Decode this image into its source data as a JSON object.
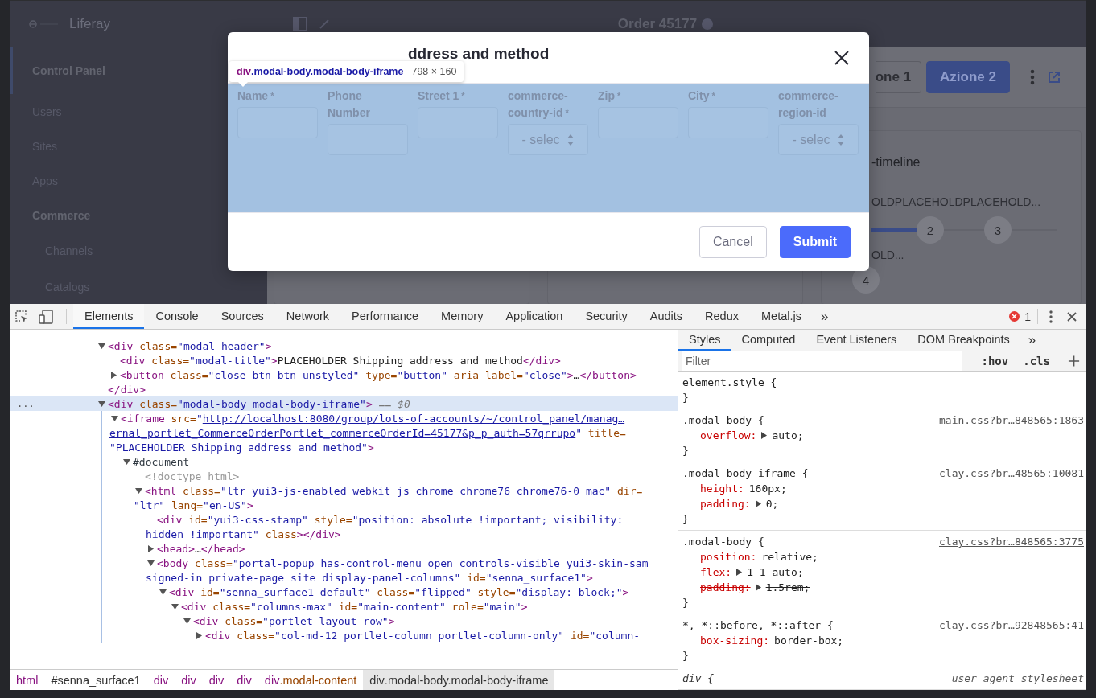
{
  "app": {
    "brand": "Liferay",
    "sidebar": [
      {
        "label": "Control Panel",
        "kind": "section",
        "selected": true
      },
      {
        "label": "Users",
        "kind": "item",
        "selected": false
      },
      {
        "label": "Sites",
        "kind": "item",
        "selected": false
      },
      {
        "label": "Apps",
        "kind": "item",
        "selected": false
      },
      {
        "label": "Commerce",
        "kind": "section",
        "selected": false
      },
      {
        "label": "Channels",
        "kind": "subitem",
        "selected": false
      },
      {
        "label": "Catalogs",
        "kind": "subitem",
        "selected": false
      }
    ],
    "title": "Order 45177",
    "actions": [
      {
        "label": "one 1",
        "kind": "secondary"
      },
      {
        "label": "Azione 2",
        "kind": "primary"
      }
    ],
    "timeline": {
      "title": "-timeline",
      "labels": [
        "OLD",
        "PLACEHOLD",
        "PLACEHOLD..."
      ],
      "steps": [
        "2",
        "3"
      ],
      "level": 0.26,
      "second_label": "OLD...",
      "second_step": "4"
    }
  },
  "modal": {
    "title": "ddress and method",
    "highlight": {
      "element": "div",
      "classes": ".modal-body.modal-body-iframe",
      "size": "798 × 160"
    },
    "fields": [
      {
        "label": "Name",
        "mark": "*",
        "kind": "input"
      },
      {
        "label": "Phone Number",
        "kind": "input"
      },
      {
        "label": "Street 1",
        "mark": "*",
        "kind": "input"
      },
      {
        "label": "commerce-country-id",
        "mark": "*",
        "kind": "select",
        "value": "- selec"
      },
      {
        "label": "Zip",
        "mark": "*",
        "kind": "input"
      },
      {
        "label": "City",
        "mark": "*",
        "kind": "input"
      },
      {
        "label": "commerce-region-id",
        "kind": "select",
        "value": "- selec"
      }
    ],
    "buttons": [
      {
        "label": "Cancel",
        "kind": "secondary"
      },
      {
        "label": "Submit",
        "kind": "primary"
      }
    ]
  },
  "devtools": {
    "tabs": [
      {
        "label": "Elements",
        "selected": true
      },
      {
        "label": "Console",
        "selected": false
      },
      {
        "label": "Sources",
        "selected": false
      },
      {
        "label": "Network",
        "selected": false
      },
      {
        "label": "Performance",
        "selected": false
      },
      {
        "label": "Memory",
        "selected": false
      },
      {
        "label": "Application",
        "selected": false
      },
      {
        "label": "Security",
        "selected": false
      },
      {
        "label": "Audits",
        "selected": false
      },
      {
        "label": "Redux",
        "selected": false
      },
      {
        "label": "Metal.js",
        "selected": false
      }
    ],
    "more": "»",
    "error_count": "1",
    "tree": [
      {
        "expanded": true,
        "selected": false,
        "lines": [
          [
            {
              "kind": "tag",
              "text": "<div"
            },
            {
              "kind": "attr",
              "text": " class="
            },
            {
              "kind": "val",
              "text": "\"modal-header\""
            },
            {
              "kind": "tag",
              "text": ">"
            }
          ]
        ],
        "children": [
          {
            "selected": false,
            "lines": [
              [
                {
                  "kind": "tag",
                  "text": "<div"
                },
                {
                  "kind": "attr",
                  "text": " class="
                },
                {
                  "kind": "val",
                  "text": "\"modal-title\""
                },
                {
                  "kind": "tag",
                  "text": ">"
                },
                {
                  "kind": "text",
                  "text": "PLACEHOLDER Shipping address and method"
                },
                {
                  "kind": "tag",
                  "text": "</div>"
                }
              ]
            ]
          },
          {
            "expanded": false,
            "selected": false,
            "lines": [
              [
                {
                  "kind": "tag",
                  "text": "<button"
                },
                {
                  "kind": "attr",
                  "text": " class="
                },
                {
                  "kind": "val",
                  "text": "\"close btn btn-unstyled\""
                },
                {
                  "kind": "attr",
                  "text": " type="
                },
                {
                  "kind": "val",
                  "text": "\"button\""
                },
                {
                  "kind": "attr",
                  "text": " aria-label="
                },
                {
                  "kind": "val",
                  "text": "\"close\""
                },
                {
                  "kind": "tag",
                  "text": ">"
                },
                {
                  "kind": "text",
                  "text": "…"
                },
                {
                  "kind": "tag",
                  "text": "</button>"
                }
              ]
            ]
          }
        ]
      },
      {
        "selected": false,
        "lines": [
          [
            {
              "kind": "tag",
              "text": "</div>"
            }
          ]
        ]
      },
      {
        "expanded": true,
        "selected": true,
        "gutter": "...",
        "lines": [
          [
            {
              "kind": "tag",
              "text": "<div"
            },
            {
              "kind": "attr",
              "text": " class="
            },
            {
              "kind": "val",
              "text": "\"modal-body modal-body-iframe\""
            },
            {
              "kind": "tag",
              "text": ">"
            },
            {
              "kind": "dollar",
              "text": " == $0"
            }
          ]
        ],
        "children": [
          {
            "expanded": true,
            "selected": false,
            "lines": [
              [
                {
                  "kind": "tag",
                  "text": "<iframe"
                },
                {
                  "kind": "attr",
                  "text": " src="
                },
                {
                  "kind": "val",
                  "text": "\""
                },
                {
                  "kind": "link",
                  "text": "http://localhost:8080/group/lots-of-accounts/~/control_panel/manag…"
                }
              ],
              [
                {
                  "kind": "link",
                  "text": "ernal_portlet_CommerceOrderPortlet_commerceOrderId=45177&p_p_auth=57qrrupo"
                },
                {
                  "kind": "val",
                  "text": "\""
                },
                {
                  "kind": "attr",
                  "text": " title="
                }
              ],
              [
                {
                  "kind": "val",
                  "text": "\"PLACEHOLDER Shipping address and method\""
                },
                {
                  "kind": "tag",
                  "text": ">"
                }
              ]
            ],
            "children": [
              {
                "expanded": true,
                "selected": false,
                "lines": [
                  [
                    {
                      "kind": "node",
                      "text": "#document"
                    }
                  ]
                ],
                "children": [
                  {
                    "selected": false,
                    "lines": [
                      [
                        {
                          "kind": "muted",
                          "text": "<!doctype html>"
                        }
                      ]
                    ]
                  },
                  {
                    "expanded": true,
                    "selected": false,
                    "lines": [
                      [
                        {
                          "kind": "tag",
                          "text": "<html"
                        },
                        {
                          "kind": "attr",
                          "text": " class="
                        },
                        {
                          "kind": "val",
                          "text": "\"ltr yui3-js-enabled webkit js chrome chrome76 chrome76-0 mac\""
                        },
                        {
                          "kind": "attr",
                          "text": " dir="
                        }
                      ],
                      [
                        {
                          "kind": "val",
                          "text": "\"ltr\""
                        },
                        {
                          "kind": "attr",
                          "text": " lang="
                        },
                        {
                          "kind": "val",
                          "text": "\"en-US\""
                        },
                        {
                          "kind": "tag",
                          "text": ">"
                        }
                      ]
                    ],
                    "children": [
                      {
                        "selected": false,
                        "lines": [
                          [
                            {
                              "kind": "tag",
                              "text": "<div"
                            },
                            {
                              "kind": "attr",
                              "text": " id="
                            },
                            {
                              "kind": "val",
                              "text": "\"yui3-css-stamp\""
                            },
                            {
                              "kind": "attr",
                              "text": " style="
                            },
                            {
                              "kind": "val",
                              "text": "\"position: absolute !important; visibility:"
                            }
                          ],
                          [
                            {
                              "kind": "val",
                              "text": "hidden !important\""
                            },
                            {
                              "kind": "attr",
                              "text": " class"
                            },
                            {
                              "kind": "tag",
                              "text": "></div>"
                            }
                          ]
                        ]
                      },
                      {
                        "expanded": false,
                        "selected": false,
                        "lines": [
                          [
                            {
                              "kind": "tag",
                              "text": "<head>"
                            },
                            {
                              "kind": "text",
                              "text": "…"
                            },
                            {
                              "kind": "tag",
                              "text": "</head>"
                            }
                          ]
                        ]
                      },
                      {
                        "expanded": true,
                        "selected": false,
                        "lines": [
                          [
                            {
                              "kind": "tag",
                              "text": "<body"
                            },
                            {
                              "kind": "attr",
                              "text": " class="
                            },
                            {
                              "kind": "val",
                              "text": "\"portal-popup has-control-menu open controls-visible yui3-skin-sam"
                            }
                          ],
                          [
                            {
                              "kind": "val",
                              "text": "signed-in private-page site display-panel-columns\""
                            },
                            {
                              "kind": "attr",
                              "text": " id="
                            },
                            {
                              "kind": "val",
                              "text": "\"senna_surface1\""
                            },
                            {
                              "kind": "tag",
                              "text": ">"
                            }
                          ]
                        ],
                        "children": [
                          {
                            "expanded": true,
                            "selected": false,
                            "lines": [
                              [
                                {
                                  "kind": "tag",
                                  "text": "<div"
                                },
                                {
                                  "kind": "attr",
                                  "text": " id="
                                },
                                {
                                  "kind": "val",
                                  "text": "\"senna_surface1-default\""
                                },
                                {
                                  "kind": "attr",
                                  "text": " class="
                                },
                                {
                                  "kind": "val",
                                  "text": "\"flipped\""
                                },
                                {
                                  "kind": "attr",
                                  "text": " style="
                                },
                                {
                                  "kind": "val",
                                  "text": "\"display: block;\""
                                },
                                {
                                  "kind": "tag",
                                  "text": ">"
                                }
                              ]
                            ],
                            "children": [
                              {
                                "expanded": true,
                                "selected": false,
                                "lines": [
                                  [
                                    {
                                      "kind": "tag",
                                      "text": "<div"
                                    },
                                    {
                                      "kind": "attr",
                                      "text": " class="
                                    },
                                    {
                                      "kind": "val",
                                      "text": "\"columns-max\""
                                    },
                                    {
                                      "kind": "attr",
                                      "text": " id="
                                    },
                                    {
                                      "kind": "val",
                                      "text": "\"main-content\""
                                    },
                                    {
                                      "kind": "attr",
                                      "text": " role="
                                    },
                                    {
                                      "kind": "val",
                                      "text": "\"main\""
                                    },
                                    {
                                      "kind": "tag",
                                      "text": ">"
                                    }
                                  ]
                                ],
                                "children": [
                                  {
                                    "expanded": true,
                                    "selected": false,
                                    "lines": [
                                      [
                                        {
                                          "kind": "tag",
                                          "text": "<div"
                                        },
                                        {
                                          "kind": "attr",
                                          "text": " class="
                                        },
                                        {
                                          "kind": "val",
                                          "text": "\"portlet-layout row\""
                                        },
                                        {
                                          "kind": "tag",
                                          "text": ">"
                                        }
                                      ]
                                    ],
                                    "children": [
                                      {
                                        "expanded": false,
                                        "selected": false,
                                        "lines": [
                                          [
                                            {
                                              "kind": "tag",
                                              "text": "<div"
                                            },
                                            {
                                              "kind": "attr",
                                              "text": " class="
                                            },
                                            {
                                              "kind": "val",
                                              "text": "\"col-md-12 portlet-column portlet-column-only\""
                                            },
                                            {
                                              "kind": "attr",
                                              "text": " id="
                                            },
                                            {
                                              "kind": "val",
                                              "text": "\"column-"
                                            }
                                          ]
                                        ]
                                      }
                                    ]
                                  }
                                ]
                              }
                            ]
                          }
                        ]
                      }
                    ]
                  }
                ]
              }
            ]
          }
        ]
      }
    ],
    "breadcrumbs": [
      {
        "tag": "html",
        "selected": false
      },
      {
        "suffix": "#senna_surface1",
        "selected": false
      },
      {
        "tag": "div",
        "selected": false
      },
      {
        "tag": "div",
        "selected": false
      },
      {
        "tag": "div",
        "selected": false
      },
      {
        "tag": "div",
        "selected": false
      },
      {
        "tag": "div",
        "suffix": ".modal-content",
        "selected": false
      },
      {
        "tag": "div",
        "suffix": ".modal-body.modal-body-iframe",
        "selected": true
      }
    ],
    "side_tabs": [
      {
        "label": "Styles",
        "selected": true
      },
      {
        "label": "Computed",
        "selected": false
      },
      {
        "label": "Event Listeners",
        "selected": false
      },
      {
        "label": "DOM Breakpoints",
        "selected": false
      }
    ],
    "side_more": "»",
    "filter": {
      "placeholder": "Filter",
      "hov": ":hov",
      "cls": ".cls"
    },
    "rules": [
      {
        "kind": "inline",
        "selector": "element.style {",
        "close": "}"
      },
      {
        "kind": "author",
        "selector": ".modal-body {",
        "source": "main.css?br…848565:1863",
        "close": "}",
        "properties": [
          {
            "name": "overflow:",
            "value": "auto;",
            "expandable": true,
            "struck": false
          }
        ]
      },
      {
        "kind": "author",
        "selector": ".modal-body-iframe {",
        "source": "clay.css?br…48565:10081",
        "close": "}",
        "properties": [
          {
            "name": "height:",
            "value": "160px;",
            "expandable": false,
            "struck": false
          },
          {
            "name": "padding:",
            "value": "0;",
            "expandable": true,
            "struck": false
          }
        ]
      },
      {
        "kind": "author",
        "selector": ".modal-body {",
        "source": "clay.css?br…848565:3775",
        "close": "}",
        "properties": [
          {
            "name": "position:",
            "value": "relative;",
            "expandable": false,
            "struck": false
          },
          {
            "name": "flex:",
            "value": "1 1 auto;",
            "expandable": true,
            "struck": false
          },
          {
            "name": "padding:",
            "value": "1.5rem;",
            "expandable": true,
            "struck": true
          }
        ]
      },
      {
        "kind": "author",
        "selector": "*, *::before, *::after {",
        "source": "clay.css?br…92848565:41",
        "close": "}",
        "properties": [
          {
            "name": "box-sizing:",
            "value": "border-box;",
            "expandable": false,
            "struck": false
          }
        ]
      },
      {
        "kind": "useragent",
        "selector": "div {",
        "source": "user agent stylesheet"
      }
    ]
  }
}
